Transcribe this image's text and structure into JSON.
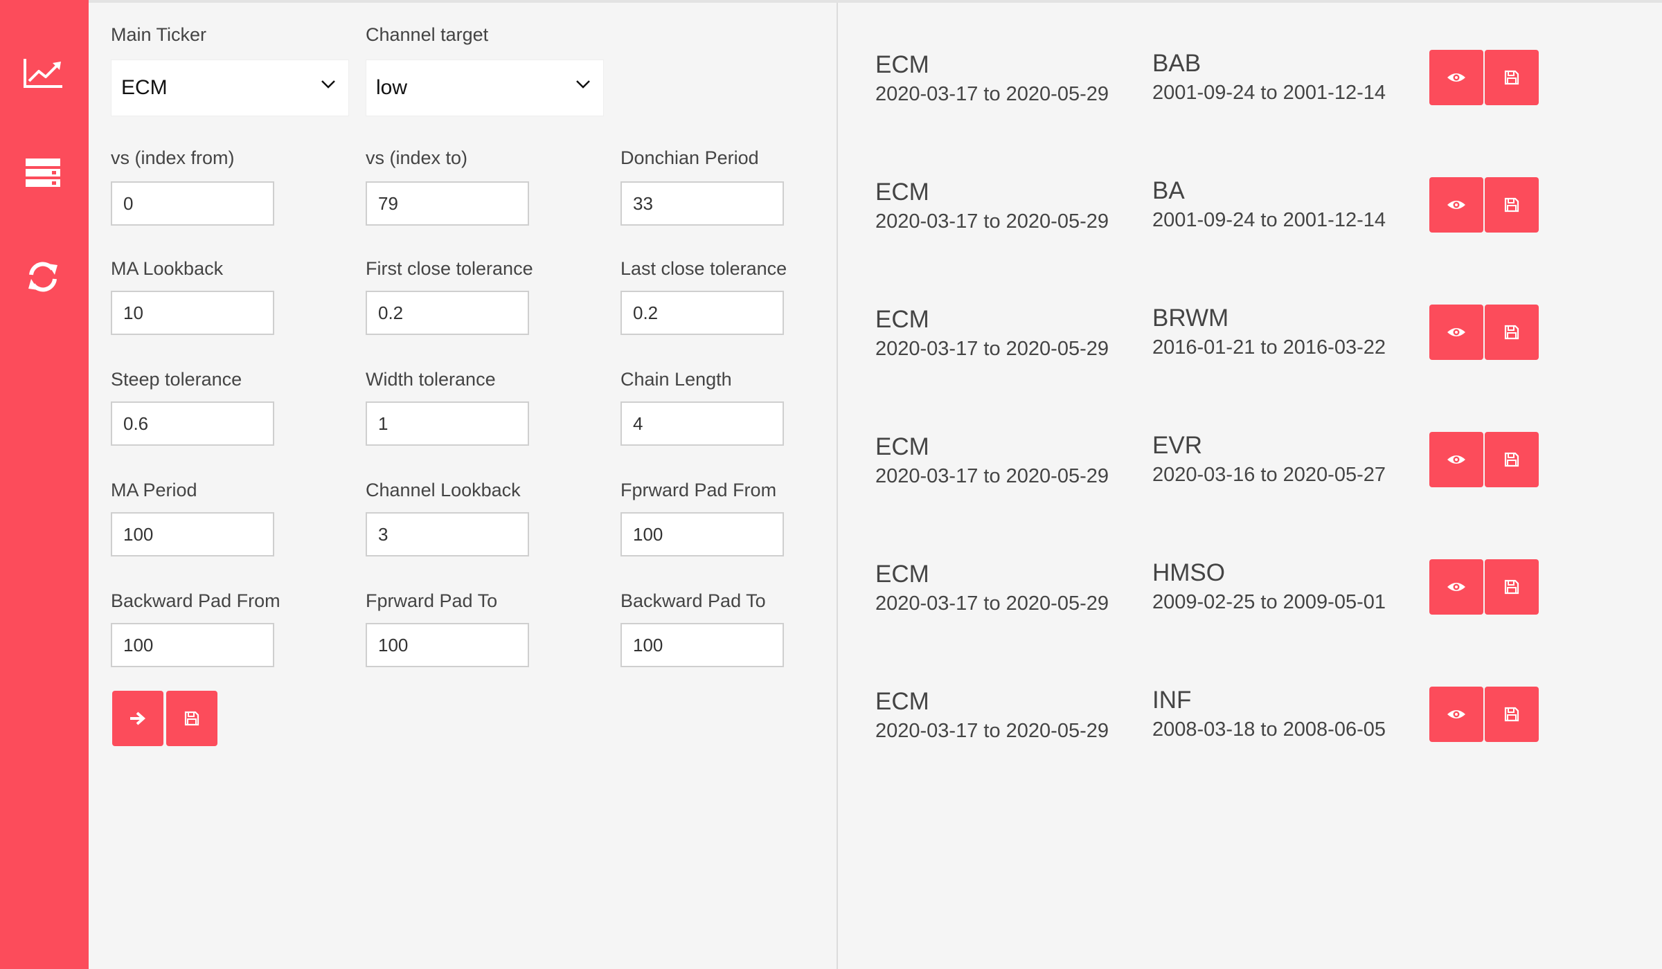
{
  "colors": {
    "accent": "#fc4c5b",
    "background": "#f5f5f5",
    "input_border": "#cfcfcf"
  },
  "sidebar": {
    "items": [
      {
        "icon": "line-chart-icon"
      },
      {
        "icon": "server-list-icon"
      },
      {
        "icon": "refresh-icon"
      }
    ]
  },
  "form": {
    "main_ticker": {
      "label": "Main Ticker",
      "value": "ECM"
    },
    "channel_target": {
      "label": "Channel target",
      "value": "low"
    },
    "fields": [
      {
        "label": "vs (index from)",
        "value": "0"
      },
      {
        "label": "vs (index to)",
        "value": "79"
      },
      {
        "label": "Donchian Period",
        "value": "33"
      },
      {
        "label": "MA Lookback",
        "value": "10"
      },
      {
        "label": "First close tolerance",
        "value": "0.2"
      },
      {
        "label": "Last close tolerance",
        "value": "0.2"
      },
      {
        "label": "Steep tolerance",
        "value": "0.6"
      },
      {
        "label": "Width tolerance",
        "value": "1"
      },
      {
        "label": "Chain Length",
        "value": "4"
      },
      {
        "label": "MA Period",
        "value": "100"
      },
      {
        "label": "Channel Lookback",
        "value": "3"
      },
      {
        "label": "Fprward Pad From",
        "value": "100"
      },
      {
        "label": "Backward Pad From",
        "value": "100"
      },
      {
        "label": "Fprward Pad To",
        "value": "100"
      },
      {
        "label": "Backward Pad To",
        "value": "100"
      }
    ],
    "run_button_icon": "arrow-right-icon",
    "save_button_icon": "floppy-disk-icon"
  },
  "results": [
    {
      "ticker_a": "ECM",
      "range_a": "2020-03-17 to 2020-05-29",
      "ticker_b": "BAB",
      "range_b": "2001-09-24 to 2001-12-14"
    },
    {
      "ticker_a": "ECM",
      "range_a": "2020-03-17 to 2020-05-29",
      "ticker_b": "BA",
      "range_b": "2001-09-24 to 2001-12-14"
    },
    {
      "ticker_a": "ECM",
      "range_a": "2020-03-17 to 2020-05-29",
      "ticker_b": "BRWM",
      "range_b": "2016-01-21 to 2016-03-22"
    },
    {
      "ticker_a": "ECM",
      "range_a": "2020-03-17 to 2020-05-29",
      "ticker_b": "EVR",
      "range_b": "2020-03-16 to 2020-05-27"
    },
    {
      "ticker_a": "ECM",
      "range_a": "2020-03-17 to 2020-05-29",
      "ticker_b": "HMSO",
      "range_b": "2009-02-25 to 2009-05-01"
    },
    {
      "ticker_a": "ECM",
      "range_a": "2020-03-17 to 2020-05-29",
      "ticker_b": "INF",
      "range_b": "2008-03-18 to 2008-06-05"
    }
  ]
}
